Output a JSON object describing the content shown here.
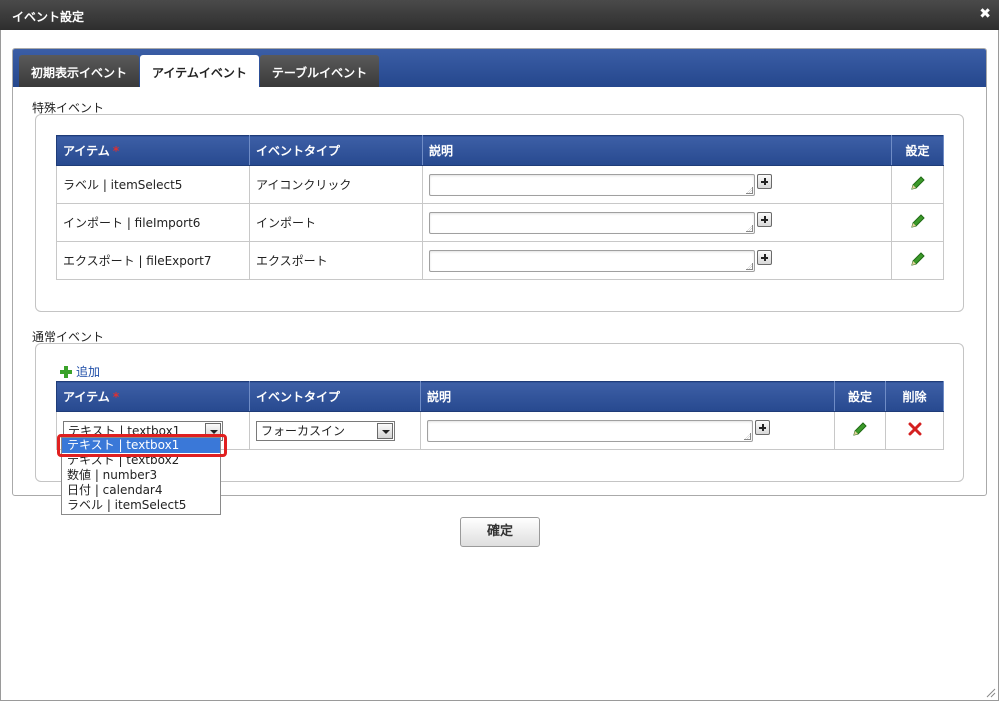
{
  "window": {
    "title": "イベント設定"
  },
  "tabs": [
    {
      "label": "初期表示イベント",
      "active": false
    },
    {
      "label": "アイテムイベント",
      "active": true
    },
    {
      "label": "テーブルイベント",
      "active": false
    }
  ],
  "special": {
    "label": "特殊イベント",
    "headers": {
      "item": "アイテム",
      "required": "*",
      "type": "イベントタイプ",
      "desc": "説明",
      "settings": "設定"
    },
    "rows": [
      {
        "item": "ラベル | itemSelect5",
        "type": "アイコンクリック",
        "desc": ""
      },
      {
        "item": "インポート | fileImport6",
        "type": "インポート",
        "desc": ""
      },
      {
        "item": "エクスポート | fileExport7",
        "type": "エクスポート",
        "desc": ""
      }
    ]
  },
  "normal": {
    "label": "通常イベント",
    "add_label": "追加",
    "headers": {
      "item": "アイテム",
      "required": "*",
      "type": "イベントタイプ",
      "desc": "説明",
      "settings": "設定",
      "delete": "削除"
    },
    "row": {
      "item_selected": "テキスト | textbox1",
      "type_selected": "フォーカスイン",
      "desc": ""
    },
    "item_options": [
      "テキスト | textbox1",
      "テキスト | textbox2",
      "数値 | number3",
      "日付 | calendar4",
      "ラベル | itemSelect5"
    ]
  },
  "footer": {
    "confirm_label": "確定"
  },
  "colors": {
    "header_blue": "#2f52a0",
    "accent_red": "#e02020",
    "pencil_green": "#3c9a2a"
  }
}
